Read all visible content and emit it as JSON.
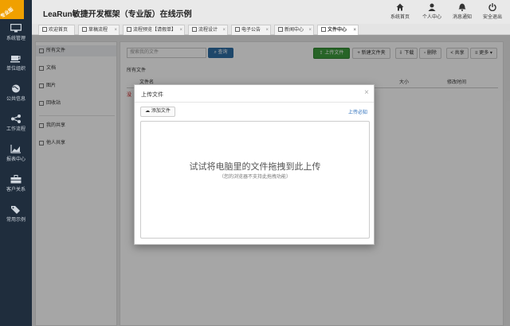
{
  "app": {
    "title": "LeaRun敏捷开发框架（专业版）在线示例",
    "badge": "专业版"
  },
  "header_actions": [
    {
      "label": "系统首页",
      "icon": "home-icon"
    },
    {
      "label": "个人中心",
      "icon": "user-icon"
    },
    {
      "label": "消息通知",
      "icon": "bell-icon"
    },
    {
      "label": "安全退出",
      "icon": "power-icon"
    }
  ],
  "sidebar": {
    "items": [
      {
        "label": "系统管理",
        "icon": "monitor-icon"
      },
      {
        "label": "单位组织",
        "icon": "coffee-icon"
      },
      {
        "label": "公共信息",
        "icon": "globe-icon"
      },
      {
        "label": "工作流程",
        "icon": "share-icon"
      },
      {
        "label": "报表中心",
        "icon": "chart-icon"
      },
      {
        "label": "客户关系",
        "icon": "briefcase-icon"
      },
      {
        "label": "常用示例",
        "icon": "tags-icon"
      }
    ]
  },
  "tabs": [
    {
      "label": "欢迎首页",
      "closable": false
    },
    {
      "label": "草稿流程",
      "closable": true
    },
    {
      "label": "流程预览【请假单】",
      "closable": true
    },
    {
      "label": "流程设计",
      "closable": true
    },
    {
      "label": "电子公告",
      "closable": true
    },
    {
      "label": "新闻中心",
      "closable": true
    },
    {
      "label": "文件中心",
      "closable": true,
      "active": true
    }
  ],
  "folders": [
    {
      "label": "所有文件",
      "selected": true
    },
    {
      "label": "文档"
    },
    {
      "label": "图片"
    },
    {
      "label": "回收站"
    },
    {
      "label": "我的共享"
    },
    {
      "label": "他人共享"
    }
  ],
  "toolbar": {
    "search_placeholder": "搜索我的文件",
    "query_label": "查询",
    "upload_label": "上传文件",
    "new_folder_label": "新建文件夹",
    "download_label": "下载",
    "delete_label": "删除",
    "share_label": "共享",
    "more_label": "更多"
  },
  "main": {
    "breadcrumb": "所有文件",
    "columns": {
      "name": "文件名",
      "size": "大小",
      "time": "修改时间"
    },
    "red_text": "没"
  },
  "modal": {
    "title": "上传文件",
    "add_file_label": "添加文件",
    "rules_link": "上传必知",
    "drop_text": "试试将电脑里的文件拖拽到此上传",
    "drop_subtext": "（您的浏览器不支持此拖拽功能）"
  },
  "colors": {
    "sidebar_bg": "#1f2d3d",
    "accent_blue": "#2e6da4",
    "upload_green": "#3c9a3c",
    "badge": "#f0a000"
  }
}
